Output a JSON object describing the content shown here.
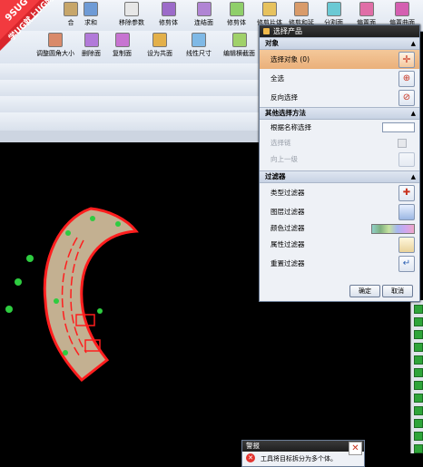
{
  "logo": {
    "brand": "9SUG",
    "slogan": "学UG就上UG网"
  },
  "ribbon": {
    "items": [
      {
        "label": "合"
      },
      {
        "label": "求和"
      },
      {
        "label": "移除参数"
      },
      {
        "label": "修剪体"
      },
      {
        "label": "连结面"
      },
      {
        "label": "修剪体"
      },
      {
        "label": "修剪片体"
      },
      {
        "label": "修剪和延"
      },
      {
        "label": "分割面"
      },
      {
        "label": "偏置面"
      },
      {
        "label": "偏置曲面"
      }
    ]
  },
  "ribbon2": {
    "items": [
      {
        "label": "调整圆角大小"
      },
      {
        "label": "删除面"
      },
      {
        "label": "复制面"
      },
      {
        "label": "设为共面"
      },
      {
        "label": "线性尺寸"
      },
      {
        "label": "编辑横截面"
      }
    ]
  },
  "dialog": {
    "title": "选择产品",
    "sections": {
      "object": {
        "header": "对象",
        "rows": [
          "选择对象 (0)",
          "全选",
          "反向选择"
        ]
      },
      "other": {
        "header": "其他选择方法",
        "rows": [
          "根据名称选择",
          "选择链",
          "向上一级"
        ]
      },
      "filter": {
        "header": "过滤器",
        "rows": [
          "类型过滤器",
          "图层过滤器",
          "颜色过滤器",
          "属性过滤器",
          "重置过滤器"
        ]
      }
    },
    "ok_label": "确定",
    "cancel_label": "取消"
  },
  "alert": {
    "title": "警报",
    "message": "工具将目标拆分为多个体。"
  },
  "colors": {
    "accent": "#e8a66b",
    "dialog_title_bg": "#2a2a2a",
    "model_fill": "#c3b091",
    "model_edge": "#ff1e1e",
    "points": "#2ecc40"
  }
}
